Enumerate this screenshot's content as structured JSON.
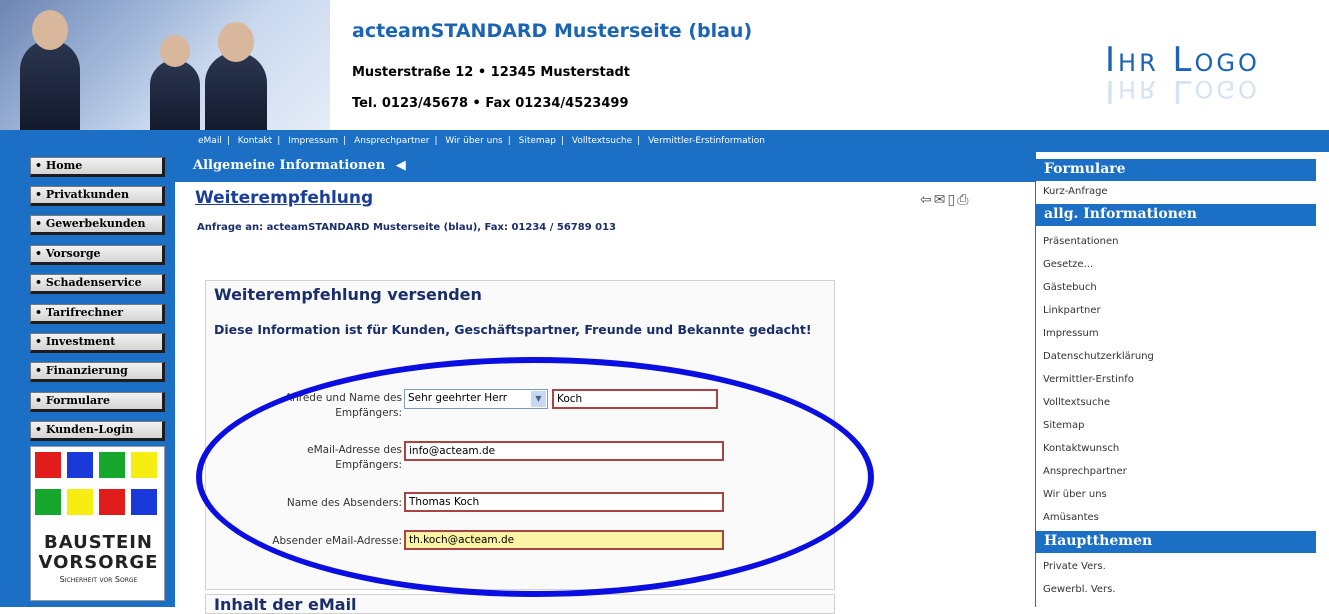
{
  "header": {
    "title": "acteamSTANDARD Musterseite (blau)",
    "address": "Musterstraße 12 • 12345 Musterstadt",
    "phone": "Tel. 0123/45678 • Fax 01234/4523499",
    "logo": "Ihr Logo"
  },
  "topnav": {
    "items": [
      "eMail",
      "Kontakt",
      "Impressum",
      "Ansprechpartner",
      "Wir über uns",
      "Sitemap",
      "Volltextsuche",
      "Vermittler-Erstinformation"
    ]
  },
  "leftnav": {
    "items": [
      "• Home",
      "• Privatkunden",
      "• Gewerbekunden",
      "• Vorsorge",
      "• Schadenservice",
      "• Tarifrechner",
      "• Investment",
      "• Finanzierung",
      "• Formulare",
      "• Kunden-Login"
    ],
    "banner": {
      "line1": "BAUSTEIN",
      "line2": "VORSORGE",
      "line3": "Sicherheit vor Sorge"
    }
  },
  "main": {
    "section": "Allgemeine Informationen",
    "title": "Weiterempfehlung",
    "request_to": "Anfrage an: acteamSTANDARD Musterseite (blau), Fax: 01234 / 56789 013",
    "form": {
      "heading": "Weiterempfehlung versenden",
      "intro": "Diese Information ist für Kunden, Geschäftspartner, Freunde und Bekannte gedacht!",
      "anrede_label": "Anrede und Name des Empfängers:",
      "anrede_value": "Sehr geehrter Herr",
      "recipient_name": "Koch",
      "recipient_email_label": "eMail-Adresse des Empfängers:",
      "recipient_email": "info@acteam.de",
      "sender_name_label": "Name des Absenders:",
      "sender_name": "Thomas Koch",
      "sender_email_label": "Absender eMail-Adresse:",
      "sender_email": "th.koch@acteam.de"
    },
    "content_heading": "Inhalt der eMail"
  },
  "rightnav": {
    "formulare": {
      "title": "Formulare",
      "items": [
        "Kurz-Anfrage"
      ]
    },
    "infos": {
      "title": "allg. Informationen",
      "items": [
        "Präsentationen",
        "Gesetze...",
        "Gästebuch",
        "Linkpartner",
        "Impressum",
        "Datenschutzerklärung",
        "Vermittler-Erstinfo",
        "Volltextsuche",
        "Sitemap",
        "Kontaktwunsch",
        "Ansprechpartner",
        "Wir über uns",
        "Amüsantes"
      ]
    },
    "hauptthemen": {
      "title": "Hauptthemen",
      "items": [
        "Private Vers.",
        "Gewerbl. Vers."
      ]
    }
  }
}
